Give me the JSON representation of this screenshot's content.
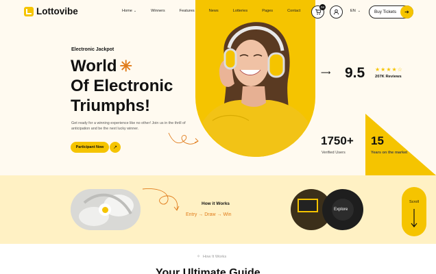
{
  "brand": {
    "name": "Lottovibe"
  },
  "nav": {
    "items": [
      {
        "label": "Home",
        "dropdown": true
      },
      {
        "label": "Winners",
        "dropdown": false
      },
      {
        "label": "Features",
        "dropdown": false
      },
      {
        "label": "News",
        "dropdown": false
      },
      {
        "label": "Lotteries",
        "dropdown": false
      },
      {
        "label": "Pages",
        "dropdown": false
      },
      {
        "label": "Contact",
        "dropdown": false
      }
    ]
  },
  "header": {
    "cart_count": "04",
    "language": "EN",
    "buy_label": "Buy Tickets"
  },
  "hero": {
    "eyebrow": "Electronic Jackpot",
    "line1": "World",
    "line2": "Of Electronic",
    "line3": "Triumphs!",
    "description": "Get ready for a winning experience like no other! Join us in the thrill of anticipation and be the next lucky winner.",
    "cta_label": "Participant Now"
  },
  "stats": {
    "rating": "9.5",
    "rating_stars": 4.5,
    "reviews": "207K Reviews",
    "users_value": "1750+",
    "users_label": "Verified Users",
    "years_value": "15",
    "years_label": "Years on the market"
  },
  "how": {
    "title": "How it Works",
    "step1": "Entry",
    "step2": "Draw",
    "step3": "Win",
    "explore_label": "Explore",
    "scroll_label": "Scroll"
  },
  "guide": {
    "eyebrow": "How It Works",
    "title": "Your Ultimate Guide"
  },
  "colors": {
    "accent": "#f5c400",
    "orange": "#e07b1a",
    "band": "#fff1c4"
  }
}
